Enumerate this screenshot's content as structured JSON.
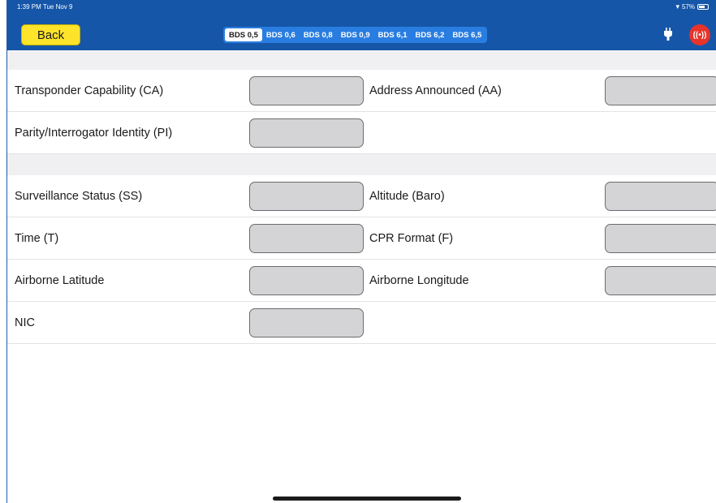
{
  "status_bar": {
    "time": "1:39 PM  Tue Nov 9",
    "battery": "57%"
  },
  "toolbar": {
    "back_label": "Back",
    "tabs": [
      "BDS 0,5",
      "BDS 0,6",
      "BDS 0,8",
      "BDS 0,9",
      "BDS 6,1",
      "BDS 6,2",
      "BDS 6,5"
    ],
    "active_tab": "BDS 0,5",
    "radio_label": "((•))"
  },
  "section1": {
    "ca_label": "Transponder Capability (CA)",
    "ca_value": "",
    "aa_label": "Address Announced (AA)",
    "aa_value": "",
    "pi_label": "Parity/Interrogator Identity (PI)",
    "pi_value": ""
  },
  "section2": {
    "ss_label": "Surveillance Status (SS)",
    "ss_value": "",
    "alt_label": "Altitude (Baro)",
    "alt_value": "",
    "time_label": "Time (T)",
    "time_value": "",
    "cpr_label": "CPR Format (F)",
    "cpr_value": "",
    "lat_label": "Airborne Latitude",
    "lat_value": "",
    "lon_label": "Airborne Longitude",
    "lon_value": "",
    "nic_label": "NIC",
    "nic_value": ""
  },
  "colors": {
    "topbar": "#1656a8",
    "back_button": "#fde42a",
    "radio_button": "#e8332a",
    "field": "#d4d4d6"
  }
}
